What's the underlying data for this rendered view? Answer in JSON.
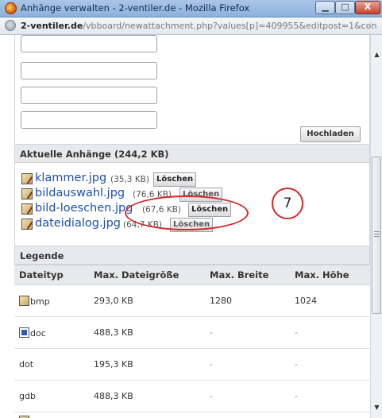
{
  "window": {
    "title": "Anhänge verwalten - 2-ventiler.de - Mozilla Firefox",
    "controls": {
      "minimize": "▁",
      "maximize": "□",
      "close": "X"
    }
  },
  "address_bar": {
    "domain": "2-ventiler.de",
    "path": "/vbboard/newattachment.php?values[p]=409955&editpost=1&con"
  },
  "upload": {
    "button_label": "Hochladen"
  },
  "attachments": {
    "header": "Aktuelle Anhänge (244,2 KB)",
    "items": [
      {
        "name": "klammer.jpg",
        "size": "(35,3 KB)",
        "delete_label": "Löschen"
      },
      {
        "name": "bildauswahl.jpg",
        "size": "(76,6 KB)",
        "delete_label": "Löschen"
      },
      {
        "name": "bild-loeschen.jpg",
        "size": "(67,6 KB)",
        "delete_label": "Löschen"
      },
      {
        "name": "dateidialog.jpg",
        "size": "(64,7 KB)",
        "delete_label": "Löschen"
      }
    ]
  },
  "annotation": {
    "number": "7",
    "color": "#d22a2a"
  },
  "legend": {
    "title": "Legende",
    "columns": [
      "Dateityp",
      "Max. Dateigröße",
      "Max. Breite",
      "Max. Höhe"
    ],
    "rows": [
      {
        "type": "bmp",
        "icon": "bmp-file-icon",
        "size": "293,0 KB",
        "width": "1280",
        "height": "1024"
      },
      {
        "type": "doc",
        "icon": "doc-file-icon",
        "size": "488,3 KB",
        "width": "-",
        "height": "-"
      },
      {
        "type": "dot",
        "icon": "",
        "size": "195,3 KB",
        "width": "-",
        "height": "-"
      },
      {
        "type": "gdb",
        "icon": "",
        "size": "488,3 KB",
        "width": "-",
        "height": "-"
      }
    ]
  }
}
